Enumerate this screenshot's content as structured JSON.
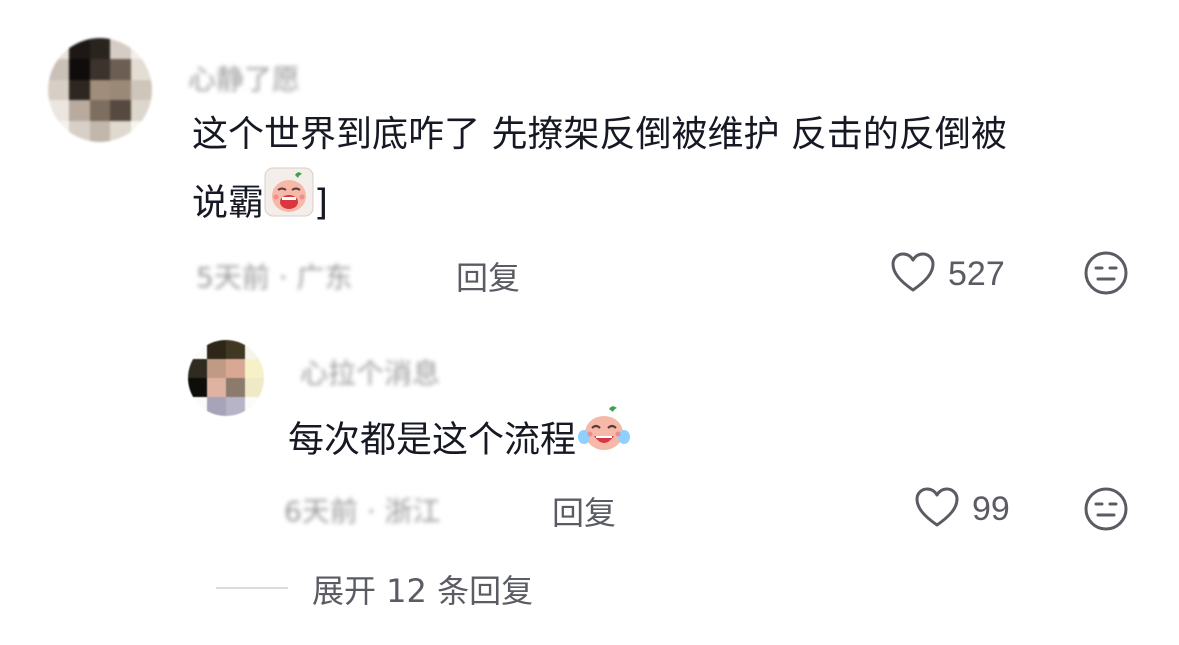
{
  "comment": {
    "username": "心静了愿",
    "text_line1": "这个世界到底咋了 先撩架反倒被维护 反击的反倒被",
    "text_line2_prefix": "说霸",
    "text_line2_suffix": "]",
    "meta": "5天前 · 广东",
    "reply_label": "回复",
    "like_count": "527"
  },
  "reply": {
    "username": "心拉个消息",
    "text": "每次都是这个流程",
    "meta": "6天前 · 浙江",
    "reply_label": "回复",
    "like_count": "99"
  },
  "expand": {
    "label": "展开 12 条回复"
  },
  "icons": {
    "like": "heart-outline-icon",
    "dislike": "neutral-face-icon",
    "emoji_cry": "crying-bun-emoji",
    "emoji_laugh_cry": "tears-of-joy-bun-emoji"
  },
  "colors": {
    "text_primary": "#161823",
    "text_secondary": "#5b5c63",
    "divider": "#dcdcdc"
  }
}
